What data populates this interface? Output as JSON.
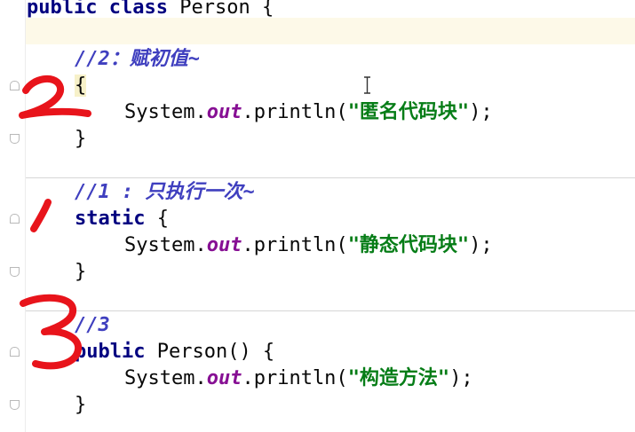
{
  "code": {
    "line_class": {
      "kw_public": "public",
      "kw_class": "class",
      "name": "Person",
      "brace": "{"
    },
    "comment_2": "//2：赋初值~",
    "block1_open": "{",
    "println1": {
      "prefix": "System.",
      "field": "out",
      "call": ".println(",
      "str": "\"匿名代码块\"",
      "end": ");"
    },
    "block1_close": "}",
    "comment_1": "//1 : 只执行一次~",
    "static_line": {
      "kw": "static",
      "brace": " {"
    },
    "println2": {
      "prefix": "System.",
      "field": "out",
      "call": ".println(",
      "str": "\"静态代码块\"",
      "end": ");"
    },
    "block2_close": "}",
    "comment_3": "//3",
    "ctor_line": {
      "kw": "public",
      "rest": " Person() {"
    },
    "println3": {
      "prefix": "System.",
      "field": "out",
      "call": ".println(",
      "str": "\"构造方法\"",
      "end": ");"
    },
    "block3_close": "}"
  },
  "annotations": {
    "colors": {
      "marker": "#e8141b"
    },
    "digits": [
      "2",
      "1",
      "3"
    ]
  },
  "icons": [
    "fold-marker-icon",
    "text-cursor-icon"
  ]
}
